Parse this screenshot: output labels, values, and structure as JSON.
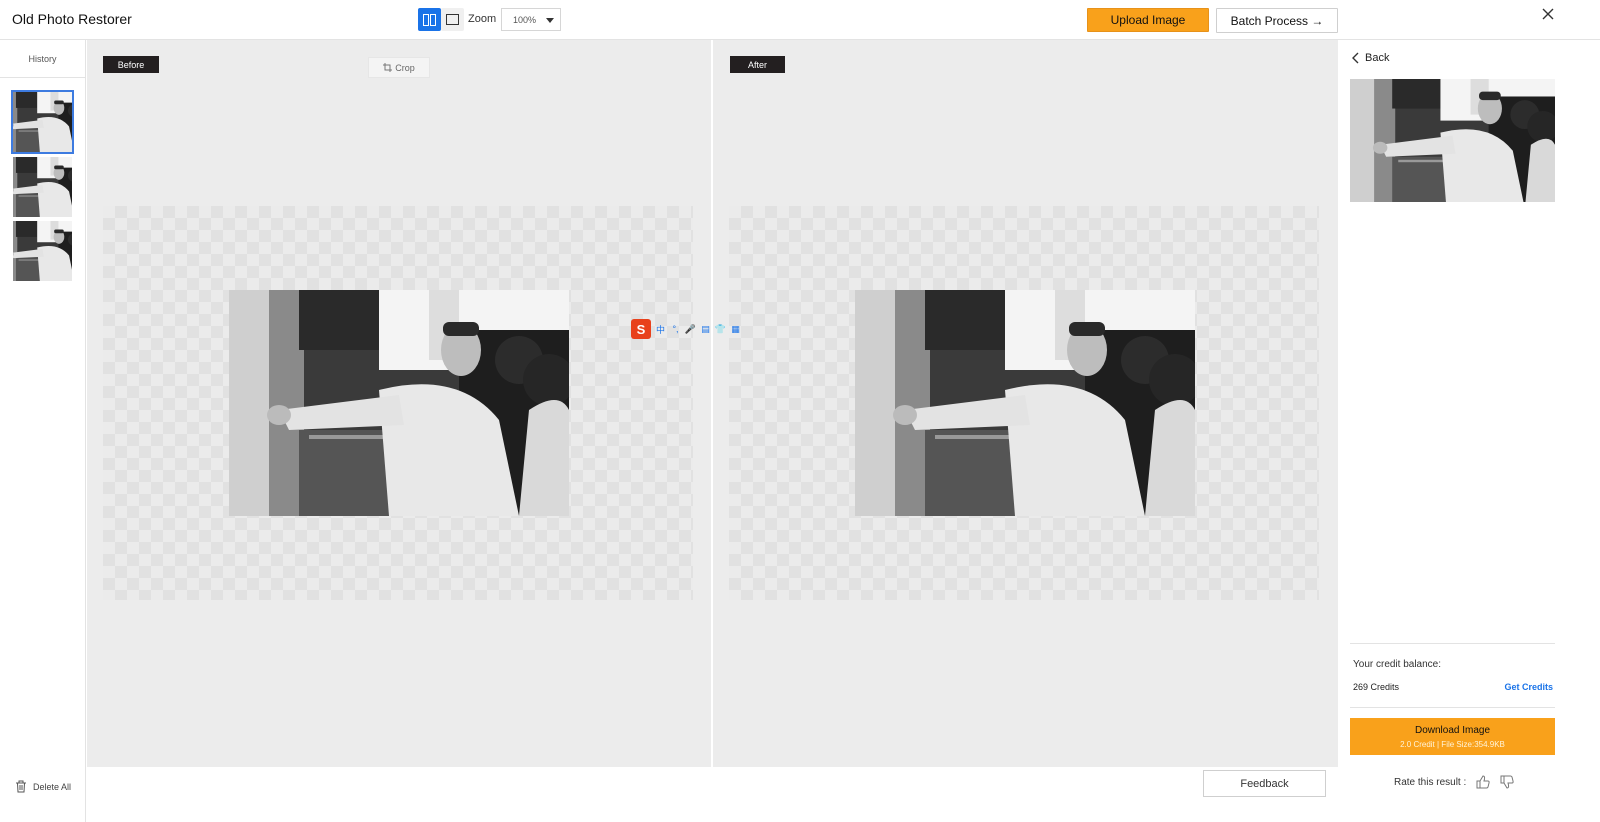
{
  "header": {
    "app_title": "Old Photo Restorer",
    "zoom_label": "Zoom",
    "zoom_value": "100%",
    "upload_label": "Upload Image",
    "batch_label": "Batch Process →"
  },
  "sidebar": {
    "history_title": "History",
    "delete_all_label": "Delete All"
  },
  "canvas": {
    "before_label": "Before",
    "after_label": "After",
    "crop_label": "Crop",
    "ime_glyph": "S",
    "ime_items": [
      "中",
      "°,",
      "🎤",
      "▤",
      "👕",
      "▦"
    ]
  },
  "right_panel": {
    "back_label": "Back",
    "credit_label": "Your credit balance:",
    "credit_value": "269 Credits",
    "get_credits_label": "Get Credits",
    "download_label": "Download Image",
    "download_sub": "2.0 Credit | File Size:354.9KB",
    "rate_label": "Rate this result :"
  },
  "footer": {
    "feedback_label": "Feedback"
  },
  "colors": {
    "accent_orange": "#f9a11b",
    "link_blue": "#1a73e8",
    "tag_dark": "#231f20"
  }
}
